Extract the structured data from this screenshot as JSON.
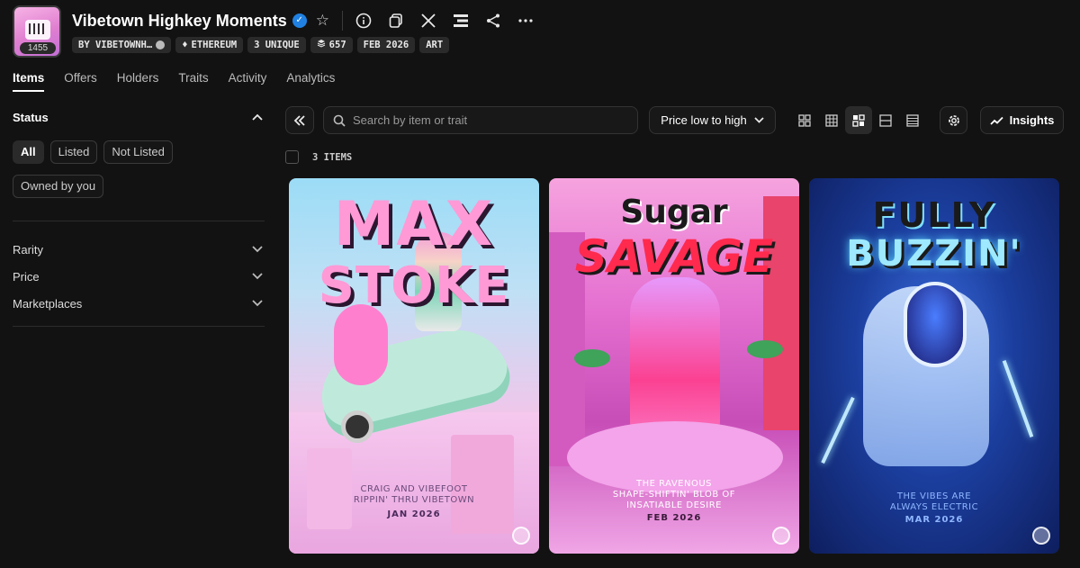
{
  "collection": {
    "title": "Vibetown Highkey Moments",
    "avatar_count": "1455",
    "tags": [
      {
        "label": "BY VIBETOWNH…",
        "icon": "verified-icon"
      },
      {
        "label": "ETHEREUM",
        "icon": "ethereum-icon"
      },
      {
        "label": "3 UNIQUE",
        "icon": ""
      },
      {
        "label": "657",
        "icon": "layers-icon"
      },
      {
        "label": "FEB 2026",
        "icon": ""
      },
      {
        "label": "ART",
        "icon": ""
      }
    ],
    "header_icons": [
      "info-icon",
      "copy-icon",
      "x-icon",
      "stack-icon",
      "share-icon",
      "more-icon"
    ]
  },
  "tabs": [
    "Items",
    "Offers",
    "Holders",
    "Traits",
    "Activity",
    "Analytics"
  ],
  "sidebar": {
    "status_title": "Status",
    "status_options": [
      "All",
      "Listed",
      "Not Listed",
      "Owned by you"
    ],
    "filters": [
      "Rarity",
      "Price",
      "Marketplaces"
    ]
  },
  "toolbar": {
    "search_placeholder": "Search by item or trait",
    "sort_label": "Price low to high",
    "insights_label": "Insights"
  },
  "items_count": "3 ITEMS",
  "items": [
    {
      "title_line1": "MAX",
      "title_line2": "STOKE",
      "caption_line1": "CRAIG AND VIBEFOOT",
      "caption_line2": "RIPPIN' THRU VIBETOWN",
      "caption_line3": "",
      "date": "JAN 2026"
    },
    {
      "title_line1": "Sugar",
      "title_line2": "SAVAGE",
      "caption_line1": "THE RAVENOUS",
      "caption_line2": "SHAPE-SHIFTIN' BLOB OF",
      "caption_line3": "INSATIABLE DESIRE",
      "date": "FEB 2026"
    },
    {
      "title_line1": "FULLY",
      "title_line2": "BUZZIN'",
      "caption_line1": "THE VIBES ARE",
      "caption_line2": "ALWAYS ELECTRIC",
      "caption_line3": "",
      "date": "MAR 2026"
    }
  ],
  "colors": {
    "accent": "#2081e2",
    "background": "#121212"
  }
}
